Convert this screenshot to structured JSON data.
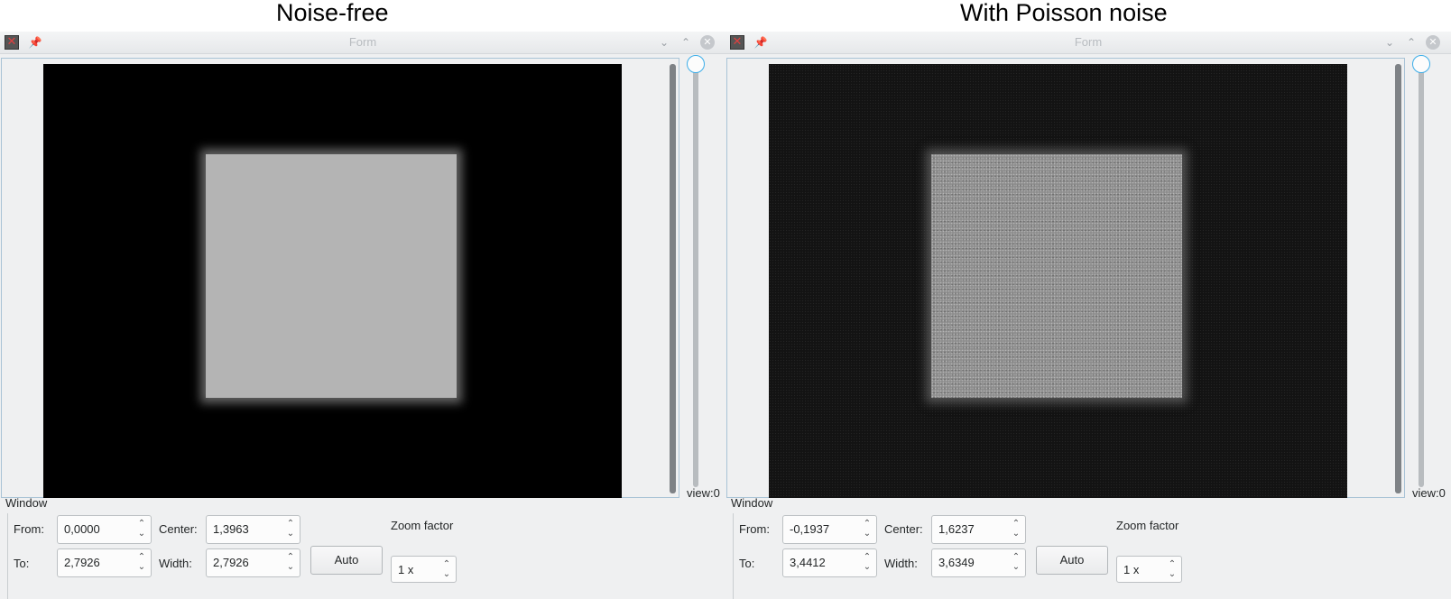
{
  "panels": [
    {
      "title": "Noise-free",
      "window_title": "Form",
      "view_label": "view:0",
      "window_group": "Window",
      "from_label": "From:",
      "from_value": "0,0000",
      "center_label": "Center:",
      "center_value": "1,3963",
      "to_label": "To:",
      "to_value": "2,7926",
      "width_label": "Width:",
      "width_value": "2,7926",
      "auto_label": "Auto",
      "zoom_label": "Zoom factor",
      "zoom_value": "1 x"
    },
    {
      "title": "With Poisson noise",
      "window_title": "Form",
      "view_label": "view:0",
      "window_group": "Window",
      "from_label": "From:",
      "from_value": "-0,1937",
      "center_label": "Center:",
      "center_value": "1,6237",
      "to_label": "To:",
      "to_value": "3,4412",
      "width_label": "Width:",
      "width_value": "3,6349",
      "auto_label": "Auto",
      "zoom_label": "Zoom factor",
      "zoom_value": "1 x"
    }
  ],
  "icons": {
    "app": "app-icon",
    "pin": "pin-icon",
    "minimize": "chevron-down-icon",
    "maximize": "chevron-up-icon",
    "close": "close-icon",
    "spin": "spin-arrows-icon"
  },
  "colors": {
    "accent": "#3daee9",
    "window_bg": "#eff0f1"
  }
}
